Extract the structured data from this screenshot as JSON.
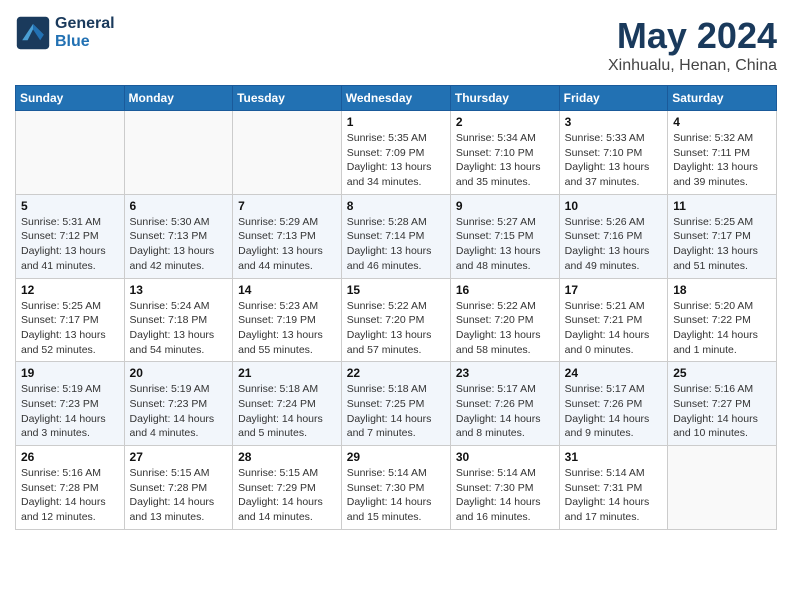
{
  "header": {
    "logo_line1": "General",
    "logo_line2": "Blue",
    "title": "May 2024",
    "subtitle": "Xinhualu, Henan, China"
  },
  "weekdays": [
    "Sunday",
    "Monday",
    "Tuesday",
    "Wednesday",
    "Thursday",
    "Friday",
    "Saturday"
  ],
  "weeks": [
    [
      {
        "day": "",
        "info": ""
      },
      {
        "day": "",
        "info": ""
      },
      {
        "day": "",
        "info": ""
      },
      {
        "day": "1",
        "info": "Sunrise: 5:35 AM\nSunset: 7:09 PM\nDaylight: 13 hours\nand 34 minutes."
      },
      {
        "day": "2",
        "info": "Sunrise: 5:34 AM\nSunset: 7:10 PM\nDaylight: 13 hours\nand 35 minutes."
      },
      {
        "day": "3",
        "info": "Sunrise: 5:33 AM\nSunset: 7:10 PM\nDaylight: 13 hours\nand 37 minutes."
      },
      {
        "day": "4",
        "info": "Sunrise: 5:32 AM\nSunset: 7:11 PM\nDaylight: 13 hours\nand 39 minutes."
      }
    ],
    [
      {
        "day": "5",
        "info": "Sunrise: 5:31 AM\nSunset: 7:12 PM\nDaylight: 13 hours\nand 41 minutes."
      },
      {
        "day": "6",
        "info": "Sunrise: 5:30 AM\nSunset: 7:13 PM\nDaylight: 13 hours\nand 42 minutes."
      },
      {
        "day": "7",
        "info": "Sunrise: 5:29 AM\nSunset: 7:13 PM\nDaylight: 13 hours\nand 44 minutes."
      },
      {
        "day": "8",
        "info": "Sunrise: 5:28 AM\nSunset: 7:14 PM\nDaylight: 13 hours\nand 46 minutes."
      },
      {
        "day": "9",
        "info": "Sunrise: 5:27 AM\nSunset: 7:15 PM\nDaylight: 13 hours\nand 48 minutes."
      },
      {
        "day": "10",
        "info": "Sunrise: 5:26 AM\nSunset: 7:16 PM\nDaylight: 13 hours\nand 49 minutes."
      },
      {
        "day": "11",
        "info": "Sunrise: 5:25 AM\nSunset: 7:17 PM\nDaylight: 13 hours\nand 51 minutes."
      }
    ],
    [
      {
        "day": "12",
        "info": "Sunrise: 5:25 AM\nSunset: 7:17 PM\nDaylight: 13 hours\nand 52 minutes."
      },
      {
        "day": "13",
        "info": "Sunrise: 5:24 AM\nSunset: 7:18 PM\nDaylight: 13 hours\nand 54 minutes."
      },
      {
        "day": "14",
        "info": "Sunrise: 5:23 AM\nSunset: 7:19 PM\nDaylight: 13 hours\nand 55 minutes."
      },
      {
        "day": "15",
        "info": "Sunrise: 5:22 AM\nSunset: 7:20 PM\nDaylight: 13 hours\nand 57 minutes."
      },
      {
        "day": "16",
        "info": "Sunrise: 5:22 AM\nSunset: 7:20 PM\nDaylight: 13 hours\nand 58 minutes."
      },
      {
        "day": "17",
        "info": "Sunrise: 5:21 AM\nSunset: 7:21 PM\nDaylight: 14 hours\nand 0 minutes."
      },
      {
        "day": "18",
        "info": "Sunrise: 5:20 AM\nSunset: 7:22 PM\nDaylight: 14 hours\nand 1 minute."
      }
    ],
    [
      {
        "day": "19",
        "info": "Sunrise: 5:19 AM\nSunset: 7:23 PM\nDaylight: 14 hours\nand 3 minutes."
      },
      {
        "day": "20",
        "info": "Sunrise: 5:19 AM\nSunset: 7:23 PM\nDaylight: 14 hours\nand 4 minutes."
      },
      {
        "day": "21",
        "info": "Sunrise: 5:18 AM\nSunset: 7:24 PM\nDaylight: 14 hours\nand 5 minutes."
      },
      {
        "day": "22",
        "info": "Sunrise: 5:18 AM\nSunset: 7:25 PM\nDaylight: 14 hours\nand 7 minutes."
      },
      {
        "day": "23",
        "info": "Sunrise: 5:17 AM\nSunset: 7:26 PM\nDaylight: 14 hours\nand 8 minutes."
      },
      {
        "day": "24",
        "info": "Sunrise: 5:17 AM\nSunset: 7:26 PM\nDaylight: 14 hours\nand 9 minutes."
      },
      {
        "day": "25",
        "info": "Sunrise: 5:16 AM\nSunset: 7:27 PM\nDaylight: 14 hours\nand 10 minutes."
      }
    ],
    [
      {
        "day": "26",
        "info": "Sunrise: 5:16 AM\nSunset: 7:28 PM\nDaylight: 14 hours\nand 12 minutes."
      },
      {
        "day": "27",
        "info": "Sunrise: 5:15 AM\nSunset: 7:28 PM\nDaylight: 14 hours\nand 13 minutes."
      },
      {
        "day": "28",
        "info": "Sunrise: 5:15 AM\nSunset: 7:29 PM\nDaylight: 14 hours\nand 14 minutes."
      },
      {
        "day": "29",
        "info": "Sunrise: 5:14 AM\nSunset: 7:30 PM\nDaylight: 14 hours\nand 15 minutes."
      },
      {
        "day": "30",
        "info": "Sunrise: 5:14 AM\nSunset: 7:30 PM\nDaylight: 14 hours\nand 16 minutes."
      },
      {
        "day": "31",
        "info": "Sunrise: 5:14 AM\nSunset: 7:31 PM\nDaylight: 14 hours\nand 17 minutes."
      },
      {
        "day": "",
        "info": ""
      }
    ]
  ]
}
